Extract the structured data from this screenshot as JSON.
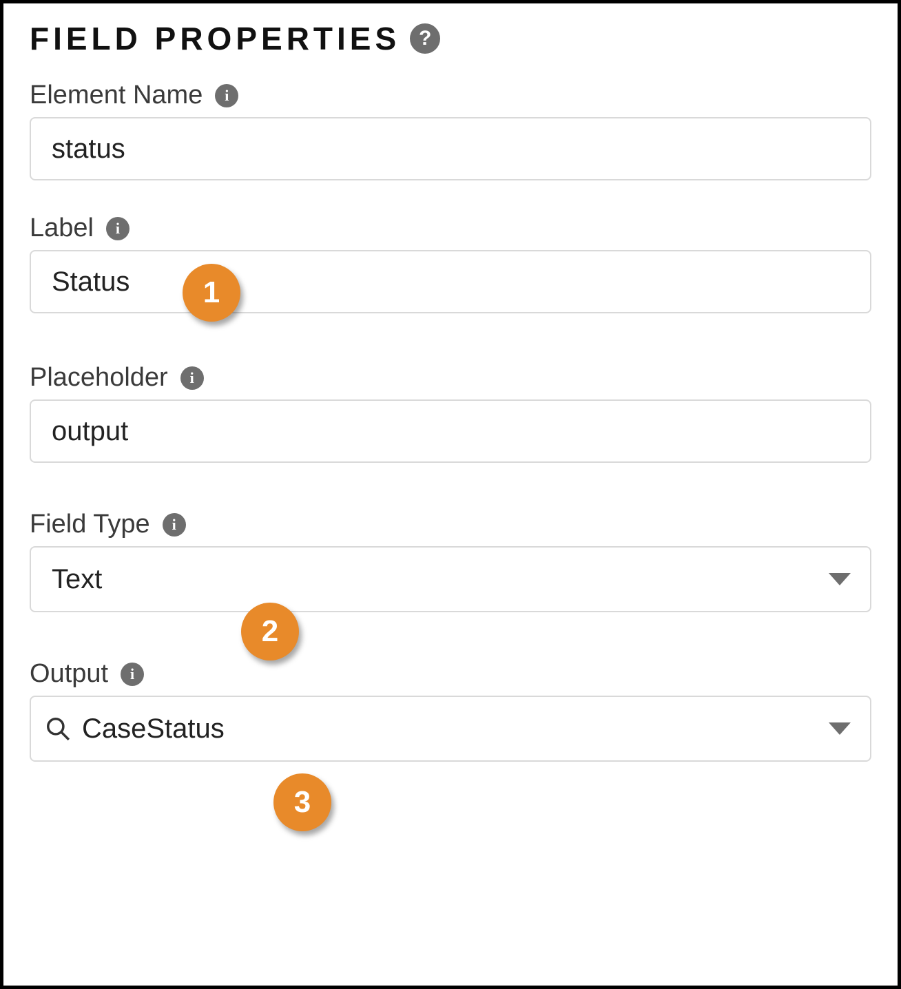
{
  "header": {
    "title": "FIELD PROPERTIES"
  },
  "fields": {
    "element_name": {
      "label": "Element Name",
      "value": "status"
    },
    "label_field": {
      "label": "Label",
      "value": "Status"
    },
    "placeholder": {
      "label": "Placeholder",
      "value": "output"
    },
    "field_type": {
      "label": "Field Type",
      "value": "Text"
    },
    "output": {
      "label": "Output",
      "value": "CaseStatus"
    }
  },
  "callouts": {
    "one": "1",
    "two": "2",
    "three": "3"
  }
}
